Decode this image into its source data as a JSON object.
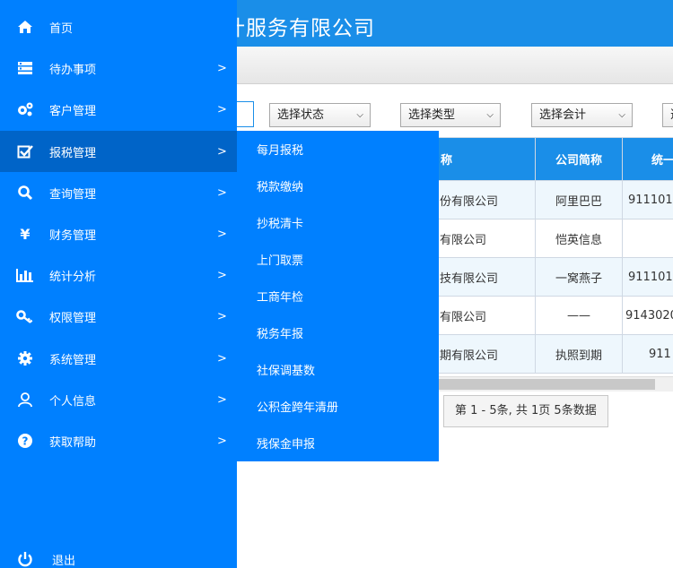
{
  "header": {
    "title": "计服务有限公司"
  },
  "filters": [
    {
      "label": "选择状态",
      "chevron": "chevron-down-icon"
    },
    {
      "label": "选择类型",
      "chevron": "chevron-down-icon"
    },
    {
      "label": "选择会计",
      "chevron": "chevron-down-icon"
    },
    {
      "label": "选"
    }
  ],
  "table": {
    "headers": [
      "称",
      "公司简称",
      "统一"
    ],
    "rows": [
      [
        "份有限公司",
        "阿里巴巴",
        "911101"
      ],
      [
        "有限公司",
        "恺英信息",
        ""
      ],
      [
        "技有限公司",
        "一窝燕子",
        "911101"
      ],
      [
        "有限公司",
        "——",
        "9143020"
      ],
      [
        "期有限公司",
        "执照到期",
        "911"
      ]
    ]
  },
  "pager": {
    "text": "第 1 - 5条, 共 1页 5条数据"
  },
  "sidebar": {
    "items": [
      {
        "label": "首页",
        "icon": "home-icon",
        "arrow": ""
      },
      {
        "label": "待办事项",
        "icon": "list-icon",
        "arrow": ">"
      },
      {
        "label": "客户管理",
        "icon": "cogs-icon",
        "arrow": ">"
      },
      {
        "label": "报税管理",
        "icon": "check-square-icon",
        "arrow": ">"
      },
      {
        "label": "查询管理",
        "icon": "search-icon",
        "arrow": ">"
      },
      {
        "label": "财务管理",
        "icon": "yen-icon",
        "arrow": ">"
      },
      {
        "label": "统计分析",
        "icon": "bar-chart-icon",
        "arrow": ">"
      },
      {
        "label": "权限管理",
        "icon": "key-icon",
        "arrow": ">"
      },
      {
        "label": "系统管理",
        "icon": "gear-icon",
        "arrow": ">"
      },
      {
        "label": "个人信息",
        "icon": "user-icon",
        "arrow": ">"
      },
      {
        "label": "获取帮助",
        "icon": "help-icon",
        "arrow": ">"
      }
    ],
    "logout": {
      "label": "退出",
      "icon": "power-icon"
    }
  },
  "submenu": {
    "items": [
      "每月报税",
      "税款缴纳",
      "抄税清卡",
      "上门取票",
      "工商年检",
      "税务年报",
      "社保调基数",
      "公积金跨年清册",
      "残保金申报"
    ]
  },
  "colors": {
    "sidebar": "#0080ff",
    "active": "#0064c8",
    "header": "#1a8ee8"
  }
}
